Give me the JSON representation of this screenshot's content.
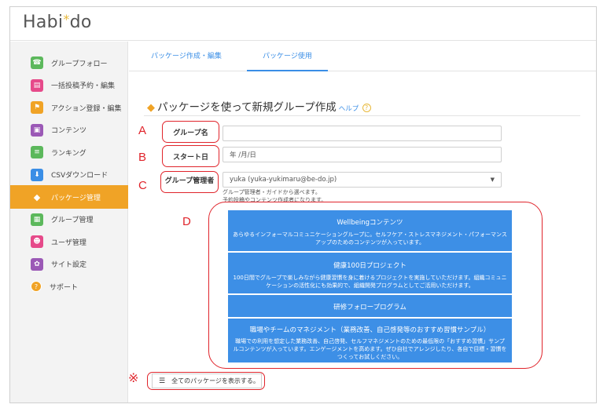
{
  "app": {
    "logo_text": "Habi",
    "logo_star": "*",
    "logo_text_end": "do"
  },
  "sidebar": {
    "items": [
      {
        "label": "グループフォロー",
        "icon": "follow-icon",
        "color": "#5cb85c"
      },
      {
        "label": "一括投稿予約・編集",
        "icon": "post-icon",
        "color": "#e64a8a"
      },
      {
        "label": "アクション登録・編集",
        "icon": "flag-icon",
        "color": "#f0a326"
      },
      {
        "label": "コンテンツ",
        "icon": "content-icon",
        "color": "#9b59b6"
      },
      {
        "label": "ランキング",
        "icon": "ranking-icon",
        "color": "#5cb85c"
      },
      {
        "label": "CSVダウンロード",
        "icon": "download-icon",
        "color": "#3a8ee6"
      },
      {
        "label": "パッケージ管理",
        "icon": "package-icon",
        "color": "#f0a326",
        "active": true
      },
      {
        "label": "グループ管理",
        "icon": "group-icon",
        "color": "#5cb85c"
      },
      {
        "label": "ユーザ管理",
        "icon": "user-icon",
        "color": "#e64a8a"
      },
      {
        "label": "サイト設定",
        "icon": "settings-icon",
        "color": "#9b59b6"
      },
      {
        "label": "サポート",
        "icon": "support-icon",
        "color": "#f0a326"
      }
    ]
  },
  "tabs": [
    {
      "label": "パッケージ作成・編集",
      "active": false
    },
    {
      "label": "パッケージ使用",
      "active": true
    }
  ],
  "main": {
    "title": "パッケージを使って新規グループ作成",
    "help_label": "ヘルプ",
    "help_icon": "?"
  },
  "annotations": {
    "a": "A",
    "b": "B",
    "c": "C",
    "d": "D",
    "note": "※"
  },
  "form": {
    "group_name_label": "グループ名",
    "group_name_value": "",
    "start_date_label": "スタート日",
    "start_date_value": "年 /月/日",
    "manager_label": "グループ管理者",
    "manager_value": "yuka (yuka-yukimaru@be-do.jp)",
    "manager_hint_1": "グループ管理者・ガイドから選べます。",
    "manager_hint_2": "予約投稿やコンテンツ作成者になります。"
  },
  "packages": [
    {
      "title": "Wellbeingコンテンツ",
      "desc": "あらゆるインフォーマルコミュニケーショングループに。セルフケア・ストレスマネジメント・パフォーマンスアップのためのコンテンツが入っています。"
    },
    {
      "title": "健康100日プロジェクト",
      "desc": "100日間でグループで楽しみながら健康習慣を身に着けるプロジェクトを実施していただけます。組織コミュニケーションの活性化にも効果的で、組織開発プログラムとしてご活用いただけます。"
    },
    {
      "title": "研修フォロープログラム",
      "desc": ""
    },
    {
      "title": "職場やチームのマネジメント（業務改善、自己啓発等のおすすめ習慣サンプル）",
      "desc": "職場での利用を想定した業務改善、自己啓発、セルフマネジメントのための最低限の「おすすめ習慣」サンプルコンテンツが入っています。エンゲージメントを高めます。ぜひ自社でアレンジしたり、各自で目標・習慣をつくってお試しください。"
    }
  ],
  "footer": {
    "show_all_label": "全てのパッケージを表示する。"
  },
  "colors": {
    "accent": "#3d8fe6",
    "active_nav": "#f0a326",
    "annotation": "#e0242b"
  }
}
